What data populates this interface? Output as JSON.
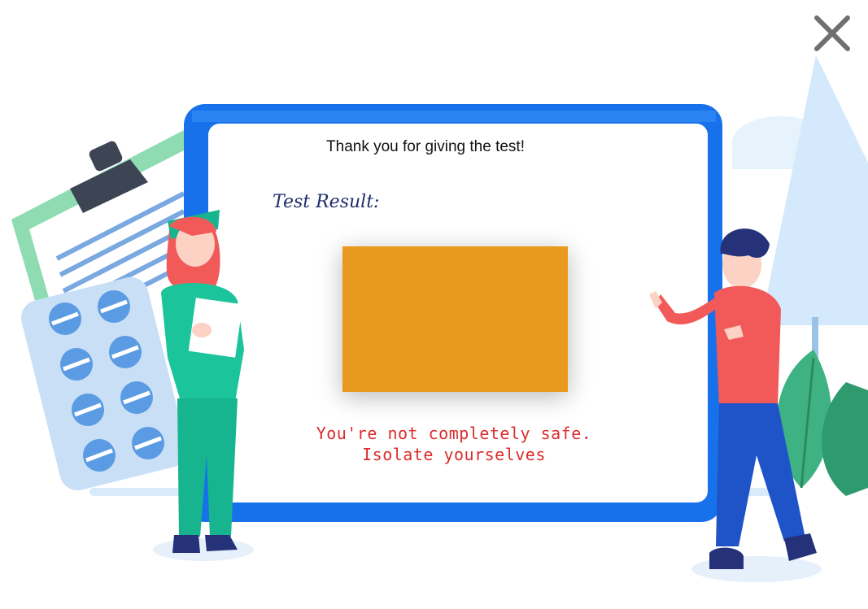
{
  "dialog": {
    "close_icon": "close-icon",
    "thanks_text": "Thank you for giving the test!",
    "result_label": "Test Result:",
    "message_line1": "You're not completely safe.",
    "message_line2": "Isolate yourselves"
  },
  "colors": {
    "result_box": "#e89a1f",
    "message": "#dc2c2c",
    "tablet_frame": "#1671ea",
    "result_label": "#1f2d6b"
  },
  "illustration": {
    "icons": [
      "clipboard-icon",
      "pill-pack-icon",
      "nurse-figure",
      "man-figure",
      "tree-icon",
      "plant-icon",
      "cloud-icon"
    ]
  }
}
